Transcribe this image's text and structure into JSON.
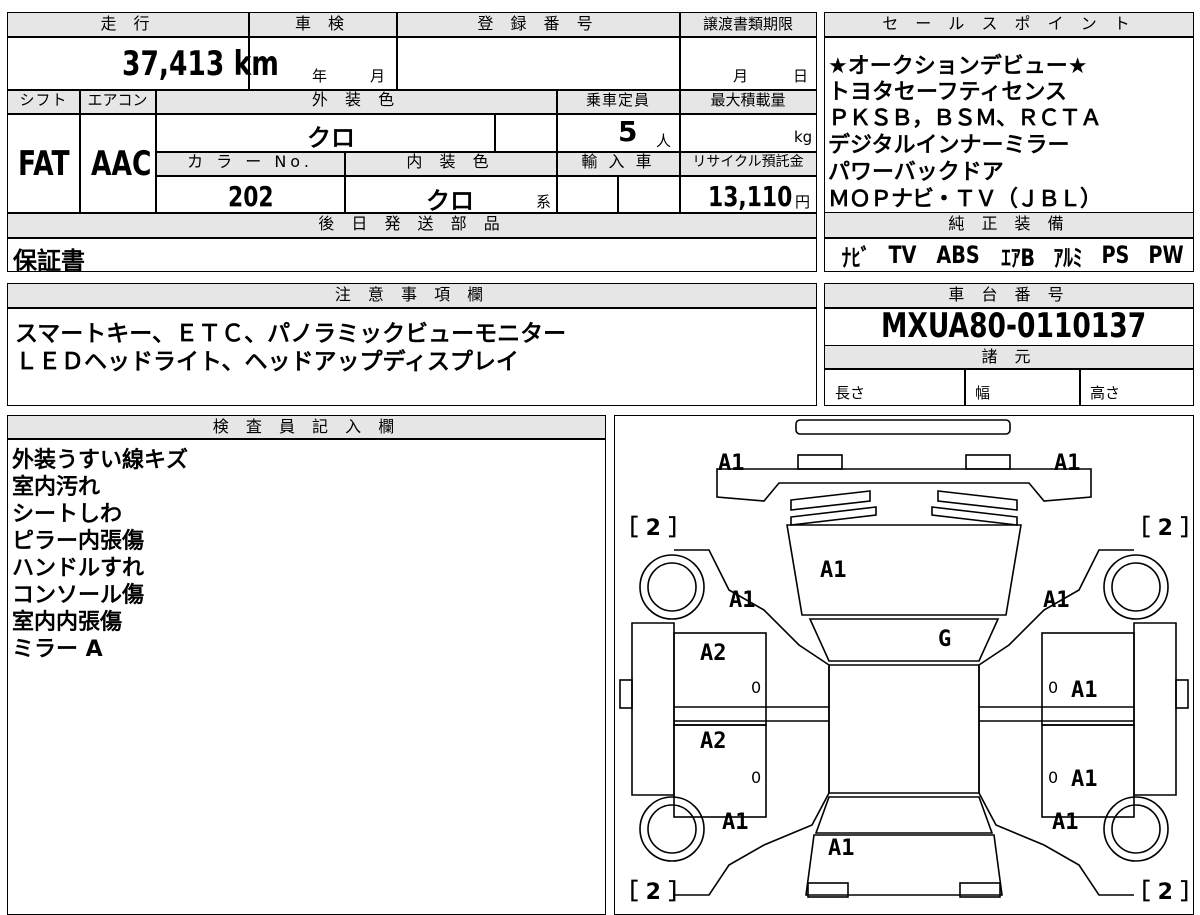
{
  "headers": {
    "mileage": "走 行",
    "inspection": "車 検",
    "registration": "登 録 番 号",
    "transfer_deadline": "譲渡書類期限",
    "shift": "シフト",
    "aircon": "エアコン",
    "exterior_color": "外 装 色",
    "capacity": "乗車定員",
    "max_load": "最大積載量",
    "color_no": "カ ラ ー No.",
    "interior_color": "内 装 色",
    "import": "輸 入 車",
    "recycle": "リサイクル預託金",
    "later_parts": "後 日 発 送 部 品",
    "sales_point": "セ ー ル ス ポ イ ン ト",
    "genuine_equipment": "純 正 装 備",
    "notes": "注 意 事 項 欄",
    "chassis_number": "車 台 番 号",
    "specs": "諸 元",
    "inspector": "検 査 員 記 入 欄"
  },
  "values": {
    "mileage": "37,413 km",
    "year_unit": "年",
    "month_unit": "月",
    "deadline_month": "月",
    "deadline_day": "日",
    "shift": "FAT",
    "aircon": "AAC",
    "exterior_color": "クロ",
    "capacity": "5",
    "capacity_unit": "人",
    "max_load_unit": "kg",
    "color_no": "202",
    "interior_color": "クロ",
    "interior_suffix": "系",
    "recycle": "13,110",
    "recycle_unit": "円",
    "later_parts": "保証書",
    "chassis_number": "MXUA80-0110137",
    "length_label": "長さ",
    "width_label": "幅",
    "height_label": "高さ"
  },
  "sales_points": [
    "★オークションデビュー★",
    "トヨタセーフティセンス",
    "ＰＫＳＢ，ＢＳＭ、ＲＣＴＡ",
    "デジタルインナーミラー",
    "パワーバックドア",
    "ＭＯＰナビ・ＴＶ（ＪＢＬ）"
  ],
  "equipment": [
    "ﾅﾋﾞ",
    "TV",
    "ABS",
    "ｴｱB",
    "ｱﾙﾐ",
    "PS",
    "PW"
  ],
  "notes": [
    "スマートキー、ＥＴＣ、パノラミックビューモニター",
    "ＬＥＤヘッドライト、ヘッドアップディスプレイ"
  ],
  "inspector_notes": [
    "外装うすい線キズ",
    "室内汚れ",
    "シートしわ",
    "ピラー内張傷",
    "ハンドルすれ",
    "コンソール傷",
    "室内内張傷",
    "ミラー A"
  ],
  "diagram": {
    "front_left": "A1",
    "front_right": "A1",
    "bonnet": "A1",
    "fender_left": "A1",
    "fender_right": "A1",
    "windshield": "G",
    "front_door_left": "A2",
    "front_door_right": "A1",
    "rear_door_left": "A2",
    "rear_door_right": "A1",
    "rear_fender_left": "A1",
    "rear_fender_right": "A1",
    "rear_center": "A1",
    "door_zero_1": "0",
    "door_zero_2": "0",
    "door_zero_3": "0",
    "door_zero_4": "0",
    "tire_fl": "［ 2 ］",
    "tire_fr": "［ 2 ］",
    "tire_rl": "［ 2 ］",
    "tire_rr": "［ 2 ］"
  }
}
